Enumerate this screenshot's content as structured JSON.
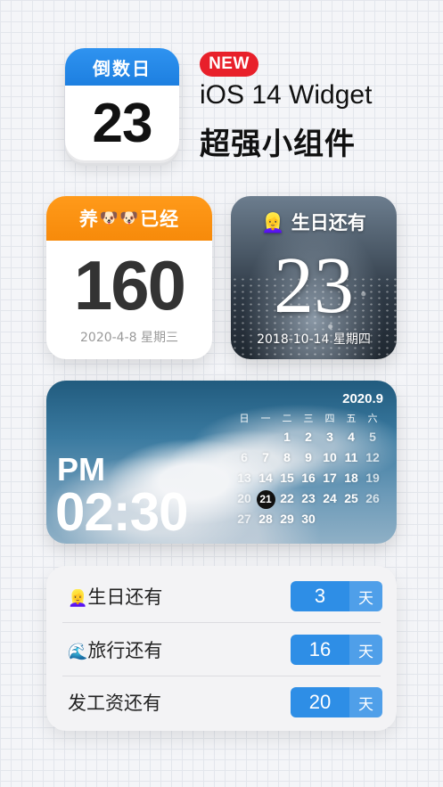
{
  "app_icon": {
    "header": "倒数日",
    "number": "23"
  },
  "heading": {
    "badge": "NEW",
    "line1": "iOS 14 Widget",
    "line2": "超强小组件"
  },
  "pet_widget": {
    "title_prefix": "养",
    "title_emoji": "🐶🐶",
    "title_suffix": "已经",
    "number": "160",
    "date": "2020-4-8 星期三"
  },
  "birthday_widget": {
    "emoji": "👱‍♀️",
    "title": "生日还有",
    "number": "23",
    "date": "2018-10-14 星期四"
  },
  "clock_widget": {
    "ampm": "PM",
    "time": "02:30",
    "calendar": {
      "month": "2020.9",
      "weekdays": [
        "日",
        "一",
        "二",
        "三",
        "四",
        "五",
        "六"
      ],
      "leading_blanks": 2,
      "days_in_month": 30,
      "today": 21
    }
  },
  "countdown_list": {
    "items": [
      {
        "emoji": "👱‍♀️",
        "label": "生日还有",
        "value": "3",
        "unit": "天"
      },
      {
        "emoji": "🌊",
        "label": "旅行还有",
        "value": "16",
        "unit": "天"
      },
      {
        "emoji": "",
        "label": "发工资还有",
        "value": "20",
        "unit": "天"
      }
    ]
  }
}
